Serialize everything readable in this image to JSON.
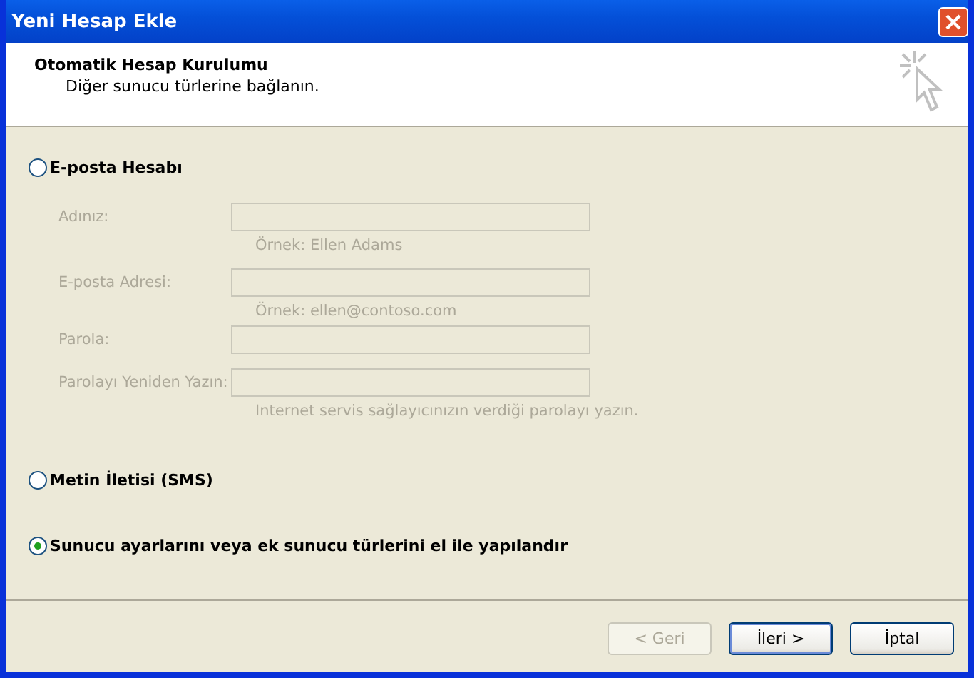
{
  "window": {
    "title": "Yeni Hesap Ekle"
  },
  "header": {
    "title": "Otomatik Hesap Kurulumu",
    "subtitle": "Diğer sunucu türlerine bağlanın."
  },
  "email_option": {
    "label": "E-posta Hesabı",
    "selected": false
  },
  "fields": [
    {
      "label": "Adınız:",
      "disabled": true,
      "hint": "Örnek: Ellen Adams"
    },
    {
      "label": "E-posta Adresi:",
      "disabled": true,
      "hint": "Örnek: ellen@contoso.com"
    },
    {
      "label": "Parola:",
      "disabled": true
    },
    {
      "label": "Parolayı Yeniden Yazın:",
      "disabled": true,
      "hint": "Internet servis sağlayıcınızın verdiği parolayı yazın."
    }
  ],
  "other_options": [
    {
      "label": "Metin İletisi (SMS)",
      "selected": false
    },
    {
      "label": "Sunucu ayarlarını veya ek sunucu türlerini el ile yapılandır",
      "selected": true
    }
  ],
  "buttons": [
    {
      "label": "< Geri",
      "disabled": true,
      "default": false
    },
    {
      "label": "İleri >",
      "disabled": false,
      "default": true
    },
    {
      "label": "İptal",
      "disabled": false,
      "default": false
    }
  ]
}
